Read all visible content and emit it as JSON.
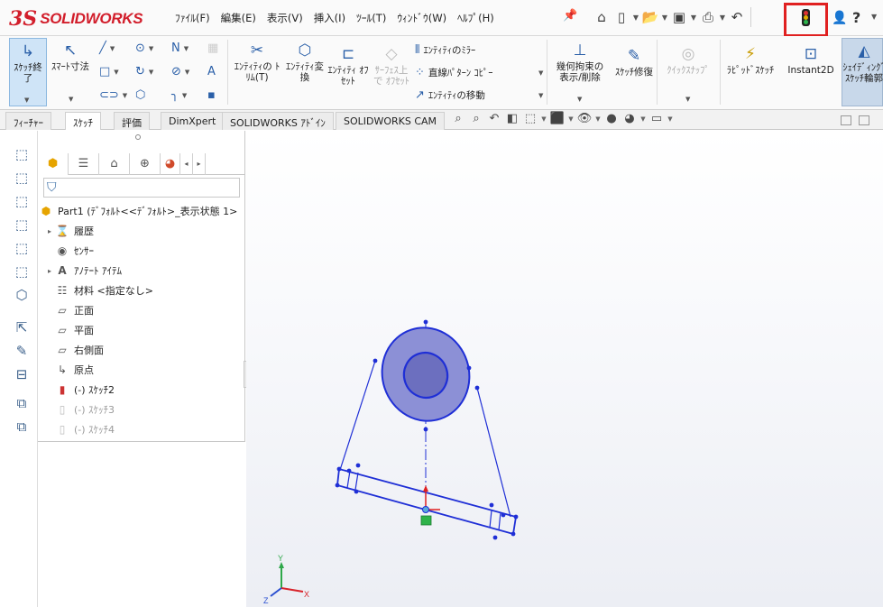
{
  "app": {
    "brand": "SOLIDWORKS",
    "brand_mark": "3S"
  },
  "menus": [
    "ﾌｧｲﾙ(F)",
    "編集(E)",
    "表示(V)",
    "挿入(I)",
    "ﾂｰﾙ(T)",
    "ｳｨﾝﾄﾞｳ(W)",
    "ﾍﾙﾌﾟ(H)"
  ],
  "ribbon": {
    "sketch_exit": "ｽｹｯﾁ終了",
    "smart_dim": "ｽﾏｰﾄ寸法",
    "trim": "ｴﾝﾃｨﾃｨの ﾄﾘﾑ(T)",
    "convert": "ｴﾝﾃｨﾃｨ変換",
    "offset": "ｴﾝﾃｨﾃｨ ｵﾌｾｯﾄ",
    "surface_offset": "ｻｰﾌｪｽ上で ｵﾌｾｯﾄ",
    "mirror": "ｴﾝﾃｨﾃｨのﾐﾗｰ",
    "linear_pattern": "直線ﾊﾟﾀｰﾝ ｺﾋﾟｰ",
    "move": "ｴﾝﾃｨﾃｨの移動",
    "relations": "幾何拘束の 表示/削除",
    "repair": "ｽｹｯﾁ修復",
    "quick_snap": "ｸｲｯｸｽﾅｯﾌﾟ",
    "rapid_sketch": "ﾗﾋﾟｯﾄﾞｽｹｯﾁ",
    "instant2d": "Instant2D",
    "shaded_sketch": "ｼｪｲﾃﾞｨﾝｸﾞ ｽｹｯﾁ輪郭"
  },
  "tabs": [
    "ﾌｨｰﾁｬｰ",
    "ｽｹｯﾁ",
    "評価",
    "DimXpert",
    "SOLIDWORKS ｱﾄﾞｲﾝ",
    "SOLIDWORKS CAM"
  ],
  "tree": {
    "root": "Part1 (ﾃﾞﾌｫﾙﾄ<<ﾃﾞﾌｫﾙﾄ>_表示状態 1>",
    "items": [
      {
        "label": "履歴",
        "expand": "▸"
      },
      {
        "label": "ｾﾝｻｰ",
        "expand": ""
      },
      {
        "label": "ｱﾉﾃｰﾄ ｱｲﾃﾑ",
        "expand": "▸"
      },
      {
        "label": "材料 <指定なし>",
        "expand": ""
      },
      {
        "label": "正面",
        "expand": ""
      },
      {
        "label": "平面",
        "expand": ""
      },
      {
        "label": "右側面",
        "expand": ""
      },
      {
        "label": "原点",
        "expand": ""
      },
      {
        "label": "(-) ｽｹｯﾁ2",
        "expand": ""
      },
      {
        "label": "(-) ｽｹｯﾁ3",
        "expand": ""
      },
      {
        "label": "(-) ｽｹｯﾁ4",
        "expand": ""
      }
    ]
  },
  "triad": {
    "x": "X",
    "y": "Y",
    "z": "Z"
  },
  "colors": {
    "accent_red": "#e02020",
    "sketch_blue": "#1f2fd6",
    "fill": "#8c90d6"
  }
}
